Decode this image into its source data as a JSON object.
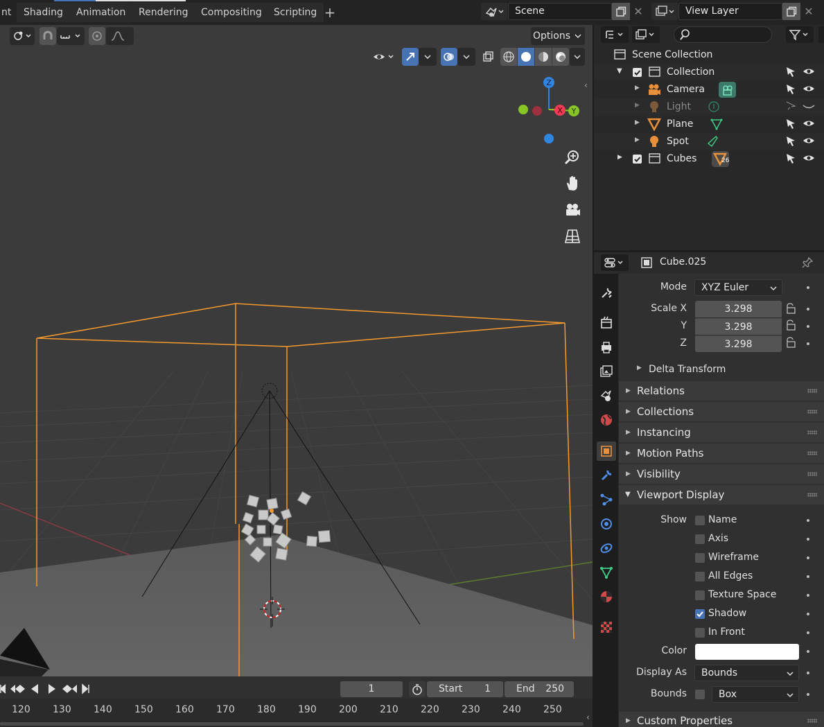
{
  "workspace_tabs": [
    "nt",
    "Shading",
    "Animation",
    "Rendering",
    "Compositing",
    "Scripting"
  ],
  "scene_field": {
    "value": "Scene"
  },
  "view_layer_field": {
    "value": "View Layer"
  },
  "viewport": {
    "options_label": "Options",
    "gizmo": {
      "z": "Z",
      "x": "X",
      "y": "Y"
    }
  },
  "timeline": {
    "current_frame": "1",
    "start_label": "Start",
    "start_value": "1",
    "end_label": "End",
    "end_value": "250",
    "ruler": [
      "120",
      "130",
      "140",
      "150",
      "160",
      "170",
      "180",
      "190",
      "200",
      "210",
      "220",
      "230",
      "240",
      "250"
    ]
  },
  "outliner": {
    "root": "Scene Collection",
    "items": [
      {
        "label": "Collection",
        "icon": "collection-icon",
        "checked": true
      },
      {
        "label": "Camera",
        "icon": "camera-icon",
        "data_icon": "camera-data-icon"
      },
      {
        "label": "Light",
        "icon": "light-icon",
        "data_icon": "light-data-icon",
        "dimmed": true
      },
      {
        "label": "Plane",
        "icon": "mesh-icon",
        "data_icon": "mesh-data-icon"
      },
      {
        "label": "Spot",
        "icon": "light-icon",
        "data_icon": "spot-data-icon"
      },
      {
        "label": "Cubes",
        "icon": "collection-icon",
        "checked": true,
        "badge": "26"
      }
    ]
  },
  "properties": {
    "object_name": "Cube.025",
    "mode_label": "Mode",
    "mode_value": "XYZ Euler",
    "scale_label": "Scale X",
    "scale_y_label": "Y",
    "scale_z_label": "Z",
    "scale_x": "3.298",
    "scale_y": "3.298",
    "scale_z": "3.298",
    "delta_transform": "Delta Transform",
    "panels": [
      "Relations",
      "Collections",
      "Instancing",
      "Motion Paths",
      "Visibility"
    ],
    "viewport_display": "Viewport Display",
    "show_label": "Show",
    "show_options": [
      {
        "label": "Name",
        "checked": false
      },
      {
        "label": "Axis",
        "checked": false
      },
      {
        "label": "Wireframe",
        "checked": false
      },
      {
        "label": "All Edges",
        "checked": false
      },
      {
        "label": "Texture Space",
        "checked": false
      },
      {
        "label": "Shadow",
        "checked": true
      },
      {
        "label": "In Front",
        "checked": false
      }
    ],
    "color_label": "Color",
    "color_value": "#ffffff",
    "display_as_label": "Display As",
    "display_as_value": "Bounds",
    "bounds_label": "Bounds",
    "bounds_value": "Box",
    "custom_properties": "Custom Properties"
  },
  "colors": {
    "accent": "#4772b3",
    "selection_orange": "#f59a2d",
    "axis_x": "#f53a55",
    "axis_y": "#88c526",
    "axis_z": "#2f85e0"
  }
}
